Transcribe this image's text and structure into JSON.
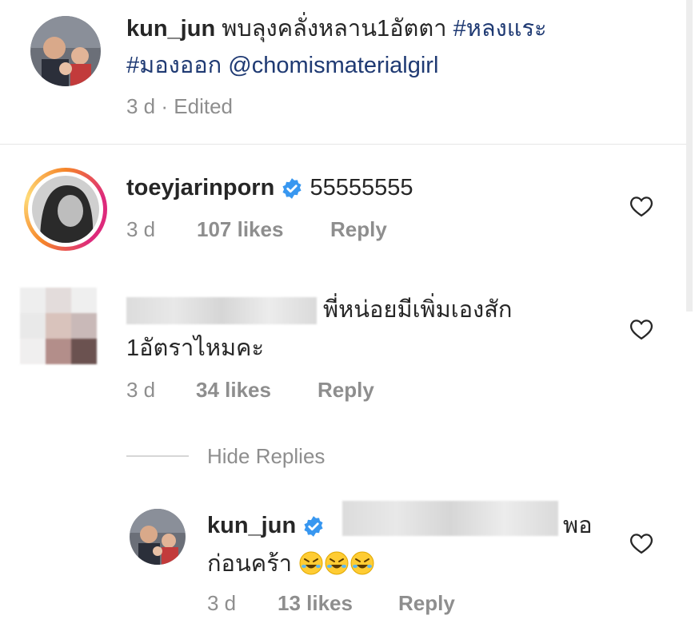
{
  "post": {
    "username": "kun_jun",
    "caption_line1": "พบลุงคลั่งหลาน1อัตตา",
    "hashtag1": "#หลงแระ",
    "hashtag2": "#มองออก",
    "mention": "@chomismaterialgirl",
    "time": "3 d",
    "edited": "Edited"
  },
  "comments": [
    {
      "username": "toeyjarinporn",
      "text": "55555555",
      "time": "3 d",
      "likes": "107 likes",
      "reply": "Reply"
    },
    {
      "text_line1": "พี่หน่อยมีเพิ่มเองสัก",
      "text_line2": "1อัตราไหมคะ",
      "time": "3 d",
      "likes": "34 likes",
      "reply": "Reply"
    }
  ],
  "hide_replies": "Hide Replies",
  "reply_comment": {
    "username": "kun_jun",
    "text_line1_end": "พอ",
    "text_line2": "ก่อนคร้า",
    "time": "3 d",
    "likes": "13 likes",
    "reply": "Reply"
  },
  "icons": {
    "heart": "heart-outline-icon",
    "verified": "verified-badge-icon",
    "emoji": "rolling-on-floor-laughing-emoji"
  },
  "colors": {
    "text": "#262626",
    "meta": "#8e8e8e",
    "hashtag": "#1f3a73",
    "verified": "#3897f0"
  }
}
